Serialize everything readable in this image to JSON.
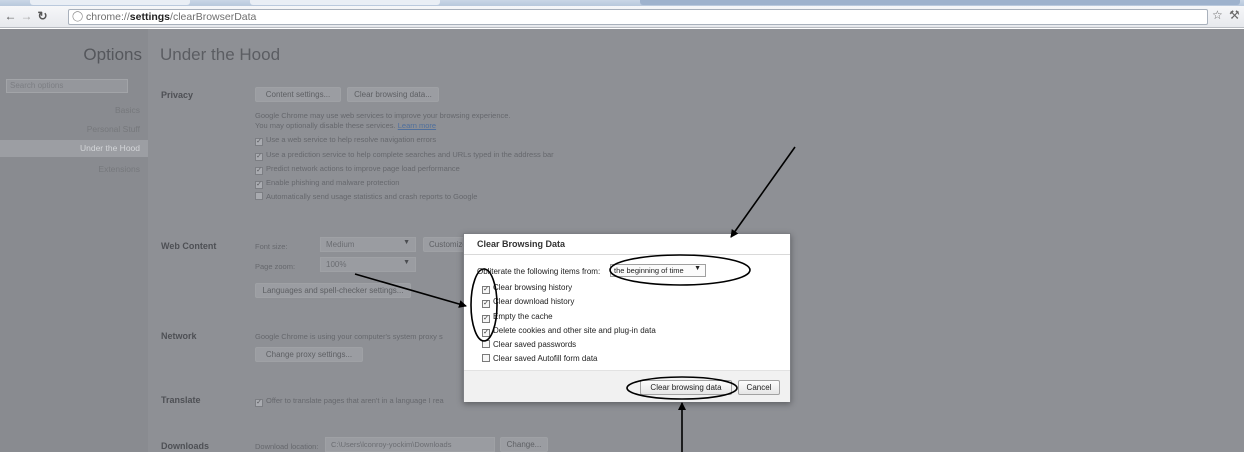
{
  "browser": {
    "url_scheme": "chrome://",
    "url_host": "settings",
    "url_path": "/clearBrowserData"
  },
  "sidebar": {
    "title": "Options",
    "search_placeholder": "Search options",
    "items": [
      {
        "label": "Basics"
      },
      {
        "label": "Personal Stuff"
      },
      {
        "label": "Under the Hood"
      },
      {
        "label": "Extensions"
      }
    ],
    "active_index": 2
  },
  "main": {
    "title": "Under the Hood",
    "privacy": {
      "label": "Privacy",
      "content_settings_btn": "Content settings...",
      "clear_data_btn": "Clear browsing data...",
      "desc_line1": "Google Chrome may use web services to improve your browsing experience.",
      "desc_line2": "You may optionally disable these services.",
      "learn_more": "Learn more",
      "options": [
        {
          "label": "Use a web service to help resolve navigation errors",
          "checked": true
        },
        {
          "label": "Use a prediction service to help complete searches and URLs typed in the address bar",
          "checked": true
        },
        {
          "label": "Predict network actions to improve page load performance",
          "checked": true
        },
        {
          "label": "Enable phishing and malware protection",
          "checked": true
        },
        {
          "label": "Automatically send usage statistics and crash reports to Google",
          "checked": false
        }
      ]
    },
    "web_content": {
      "label": "Web Content",
      "font_size_label": "Font size:",
      "font_size_value": "Medium",
      "customize_btn": "Customize",
      "page_zoom_label": "Page zoom:",
      "page_zoom_value": "100%",
      "lang_btn": "Languages and spell-checker settings..."
    },
    "network": {
      "label": "Network",
      "desc": "Google Chrome is using your computer's system proxy s",
      "proxy_btn": "Change proxy settings..."
    },
    "translate": {
      "label": "Translate",
      "option": "Offer to translate pages that aren't in a language I rea",
      "checked": true
    },
    "downloads": {
      "label": "Downloads",
      "location_label": "Download location:",
      "location_value": "C:\\Users\\lconroy-yockim\\Downloads",
      "change_btn": "Change..."
    }
  },
  "dialog": {
    "title": "Clear Browsing Data",
    "obliterate_label": "Obliterate the following items from:",
    "obliterate_value": "the beginning of time",
    "items": [
      {
        "label": "Clear browsing history",
        "checked": true
      },
      {
        "label": "Clear download history",
        "checked": true
      },
      {
        "label": "Empty the cache",
        "checked": true
      },
      {
        "label": "Delete cookies and other site and plug-in data",
        "checked": true
      },
      {
        "label": "Clear saved passwords",
        "checked": false
      },
      {
        "label": "Clear saved Autofill form data",
        "checked": false
      }
    ],
    "confirm_btn": "Clear browsing data",
    "cancel_btn": "Cancel"
  }
}
